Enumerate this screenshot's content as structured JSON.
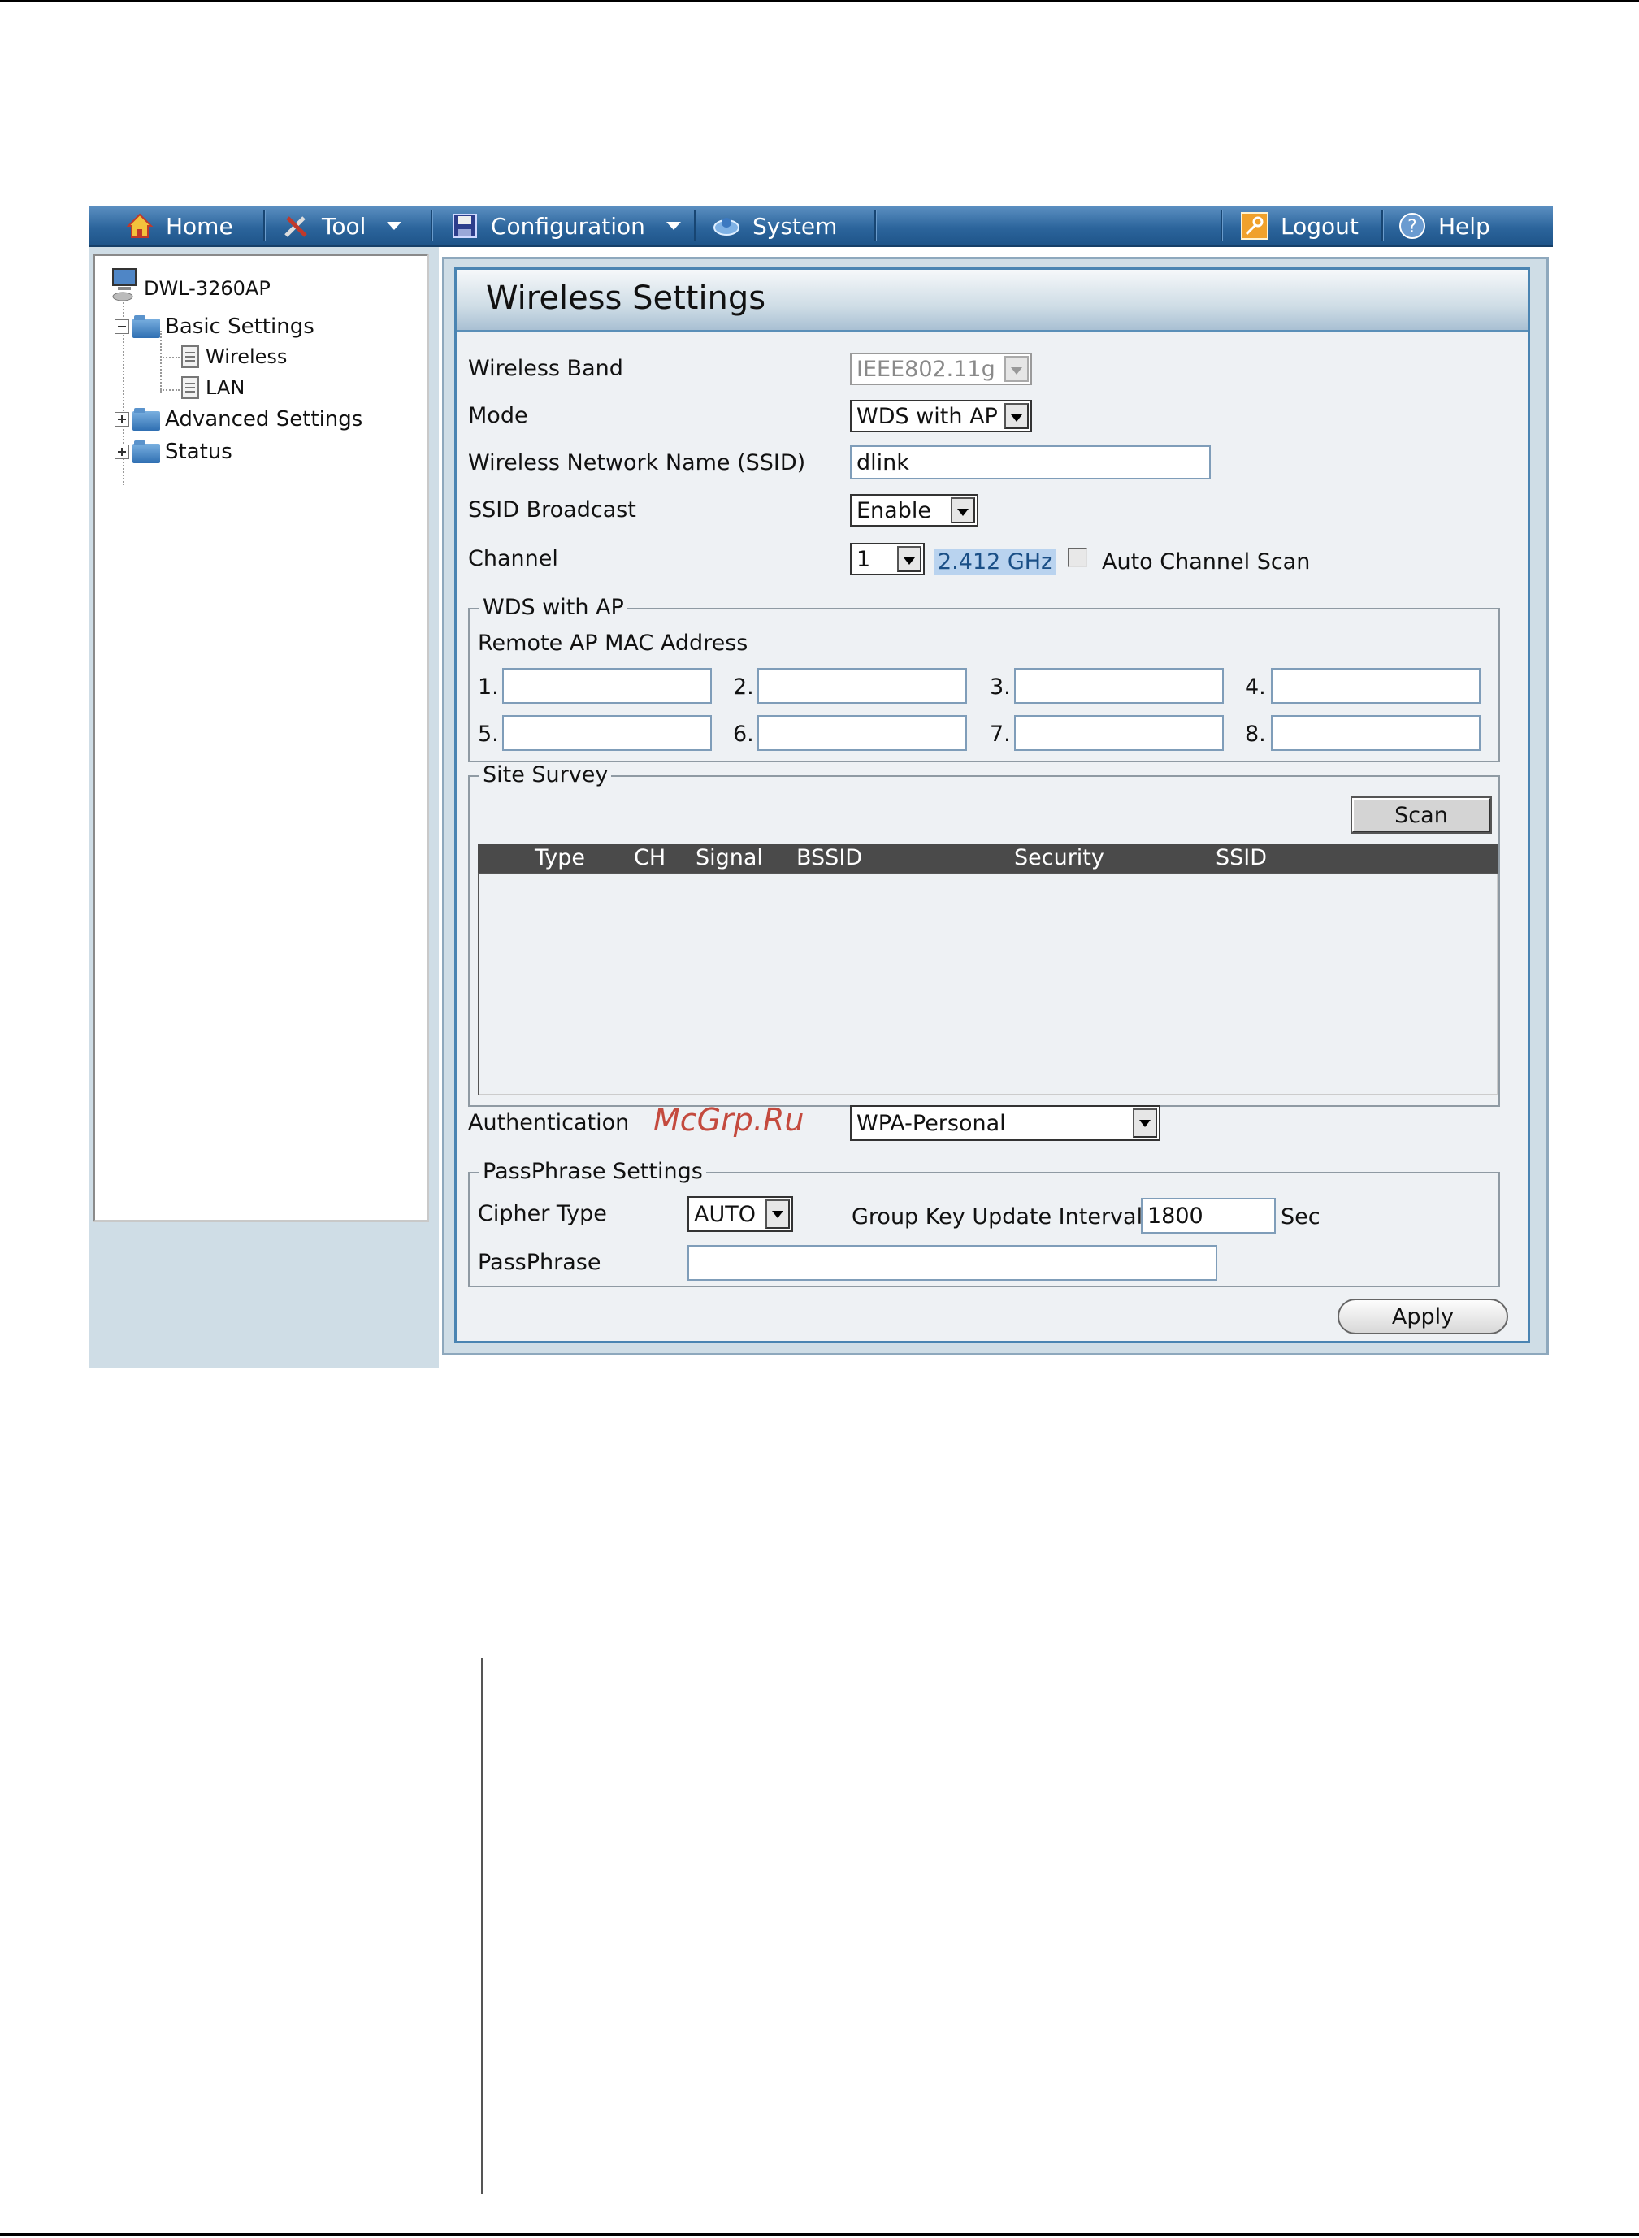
{
  "nav": {
    "home": "Home",
    "tool": "Tool",
    "configuration": "Configuration",
    "system": "System",
    "logout": "Logout",
    "help": "Help"
  },
  "tree": {
    "root": "DWL-3260AP",
    "basic_settings": "Basic Settings",
    "wireless": "Wireless",
    "lan": "LAN",
    "advanced_settings": "Advanced Settings",
    "status": "Status"
  },
  "page": {
    "title": "Wireless Settings"
  },
  "form": {
    "wireless_band": {
      "label": "Wireless Band",
      "value": "IEEE802.11g"
    },
    "mode": {
      "label": "Mode",
      "value": "WDS with AP"
    },
    "ssid": {
      "label": "Wireless Network Name (SSID)",
      "value": "dlink"
    },
    "ssid_broadcast": {
      "label": "SSID Broadcast",
      "value": "Enable"
    },
    "channel": {
      "label": "Channel",
      "value": "1",
      "frequency": "2.412 GHz",
      "auto_scan_label": "Auto Channel Scan"
    }
  },
  "wds": {
    "legend": "WDS with AP",
    "remote_label": "Remote AP MAC Address",
    "slots": [
      "1.",
      "2.",
      "3.",
      "4.",
      "5.",
      "6.",
      "7.",
      "8."
    ]
  },
  "survey": {
    "legend": "Site Survey",
    "scan_label": "Scan",
    "columns": [
      "Type",
      "CH",
      "Signal",
      "BSSID",
      "Security",
      "SSID"
    ]
  },
  "authentication": {
    "label": "Authentication",
    "value": "WPA-Personal"
  },
  "passphrase": {
    "legend": "PassPhrase Settings",
    "cipher_label": "Cipher Type",
    "cipher_value": "AUTO",
    "group_key_label": "Group Key Update Interval",
    "group_key_value": "1800",
    "group_key_unit": "Sec",
    "passphrase_label": "PassPhrase"
  },
  "apply_label": "Apply",
  "watermark": "McGrp.Ru"
}
